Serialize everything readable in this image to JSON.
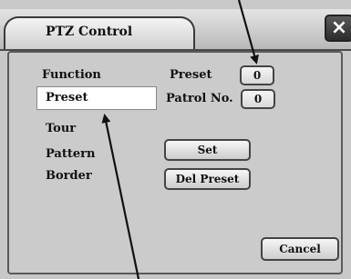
{
  "window": {
    "title": "PTZ Control",
    "close_glyph": "×"
  },
  "function_label": "Function",
  "menu": {
    "items": [
      "Preset",
      "Tour",
      "Pattern",
      "Border"
    ],
    "selected": "Preset"
  },
  "fields": {
    "preset_label": "Preset",
    "preset_value": "0",
    "patrol_label": "Patrol No.",
    "patrol_value": "0"
  },
  "buttons": {
    "set": "Set",
    "del_preset": "Del Preset",
    "cancel": "Cancel"
  },
  "colors": {
    "background": "#c8c8c8",
    "selected": "#ffffff",
    "arrow": "#111111"
  }
}
